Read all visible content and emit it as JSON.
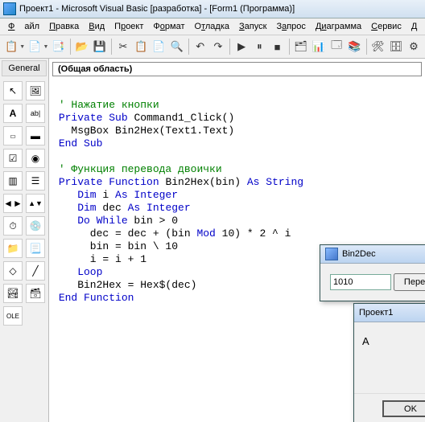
{
  "title": "Проект1 - Microsoft Visual Basic [разработка] - [Form1 (Программа)]",
  "menu": {
    "file": "Файл",
    "edit": "Правка",
    "view": "Вид",
    "project": "Проект",
    "format": "Формат",
    "debug": "Отладка",
    "run": "Запуск",
    "query": "Запрос",
    "diagram": "Диаграмма",
    "service": "Сервис",
    "addins": "Д"
  },
  "toolbox_tab": "General",
  "object_dropdown": "(Общая область)",
  "code": {
    "c1": "' Нажатие кнопки",
    "l1a": "Private",
    "l1b": " Sub",
    "l1c": " Command1_Click()",
    "l2a": "   MsgBox Bin2Hex(Text1.Text)",
    "l3": "End Sub",
    "c2": "' Функция перевода двоички",
    "l4a": "Private",
    "l4b": " Function",
    "l4c": " Bin2Hex(bin) ",
    "l4d": "As",
    "l4e": " String",
    "l5a": "    Dim",
    "l5b": " i ",
    "l5c": "As",
    "l5d": " Integer",
    "l6a": "    Dim",
    "l6b": " dec ",
    "l6c": "As",
    "l6d": " Integer",
    "l7a": "    Do While",
    "l7b": " bin > 0",
    "l8a": "      dec = dec + (bin ",
    "l8b": "Mod",
    "l8c": " 10) * 2 ^ i",
    "l9": "      bin = bin \\ 10",
    "l10": "      i = i + 1",
    "l11": "    Loop",
    "l12": "    Bin2Hex = Hex$(dec)",
    "l13": "End Function"
  },
  "dlg1": {
    "title": "Bin2Dec",
    "input": "1010",
    "button": "Перевод",
    "close": "✕"
  },
  "dlg2": {
    "title": "Проект1",
    "body": "A",
    "ok": "OK",
    "close": "✕"
  }
}
